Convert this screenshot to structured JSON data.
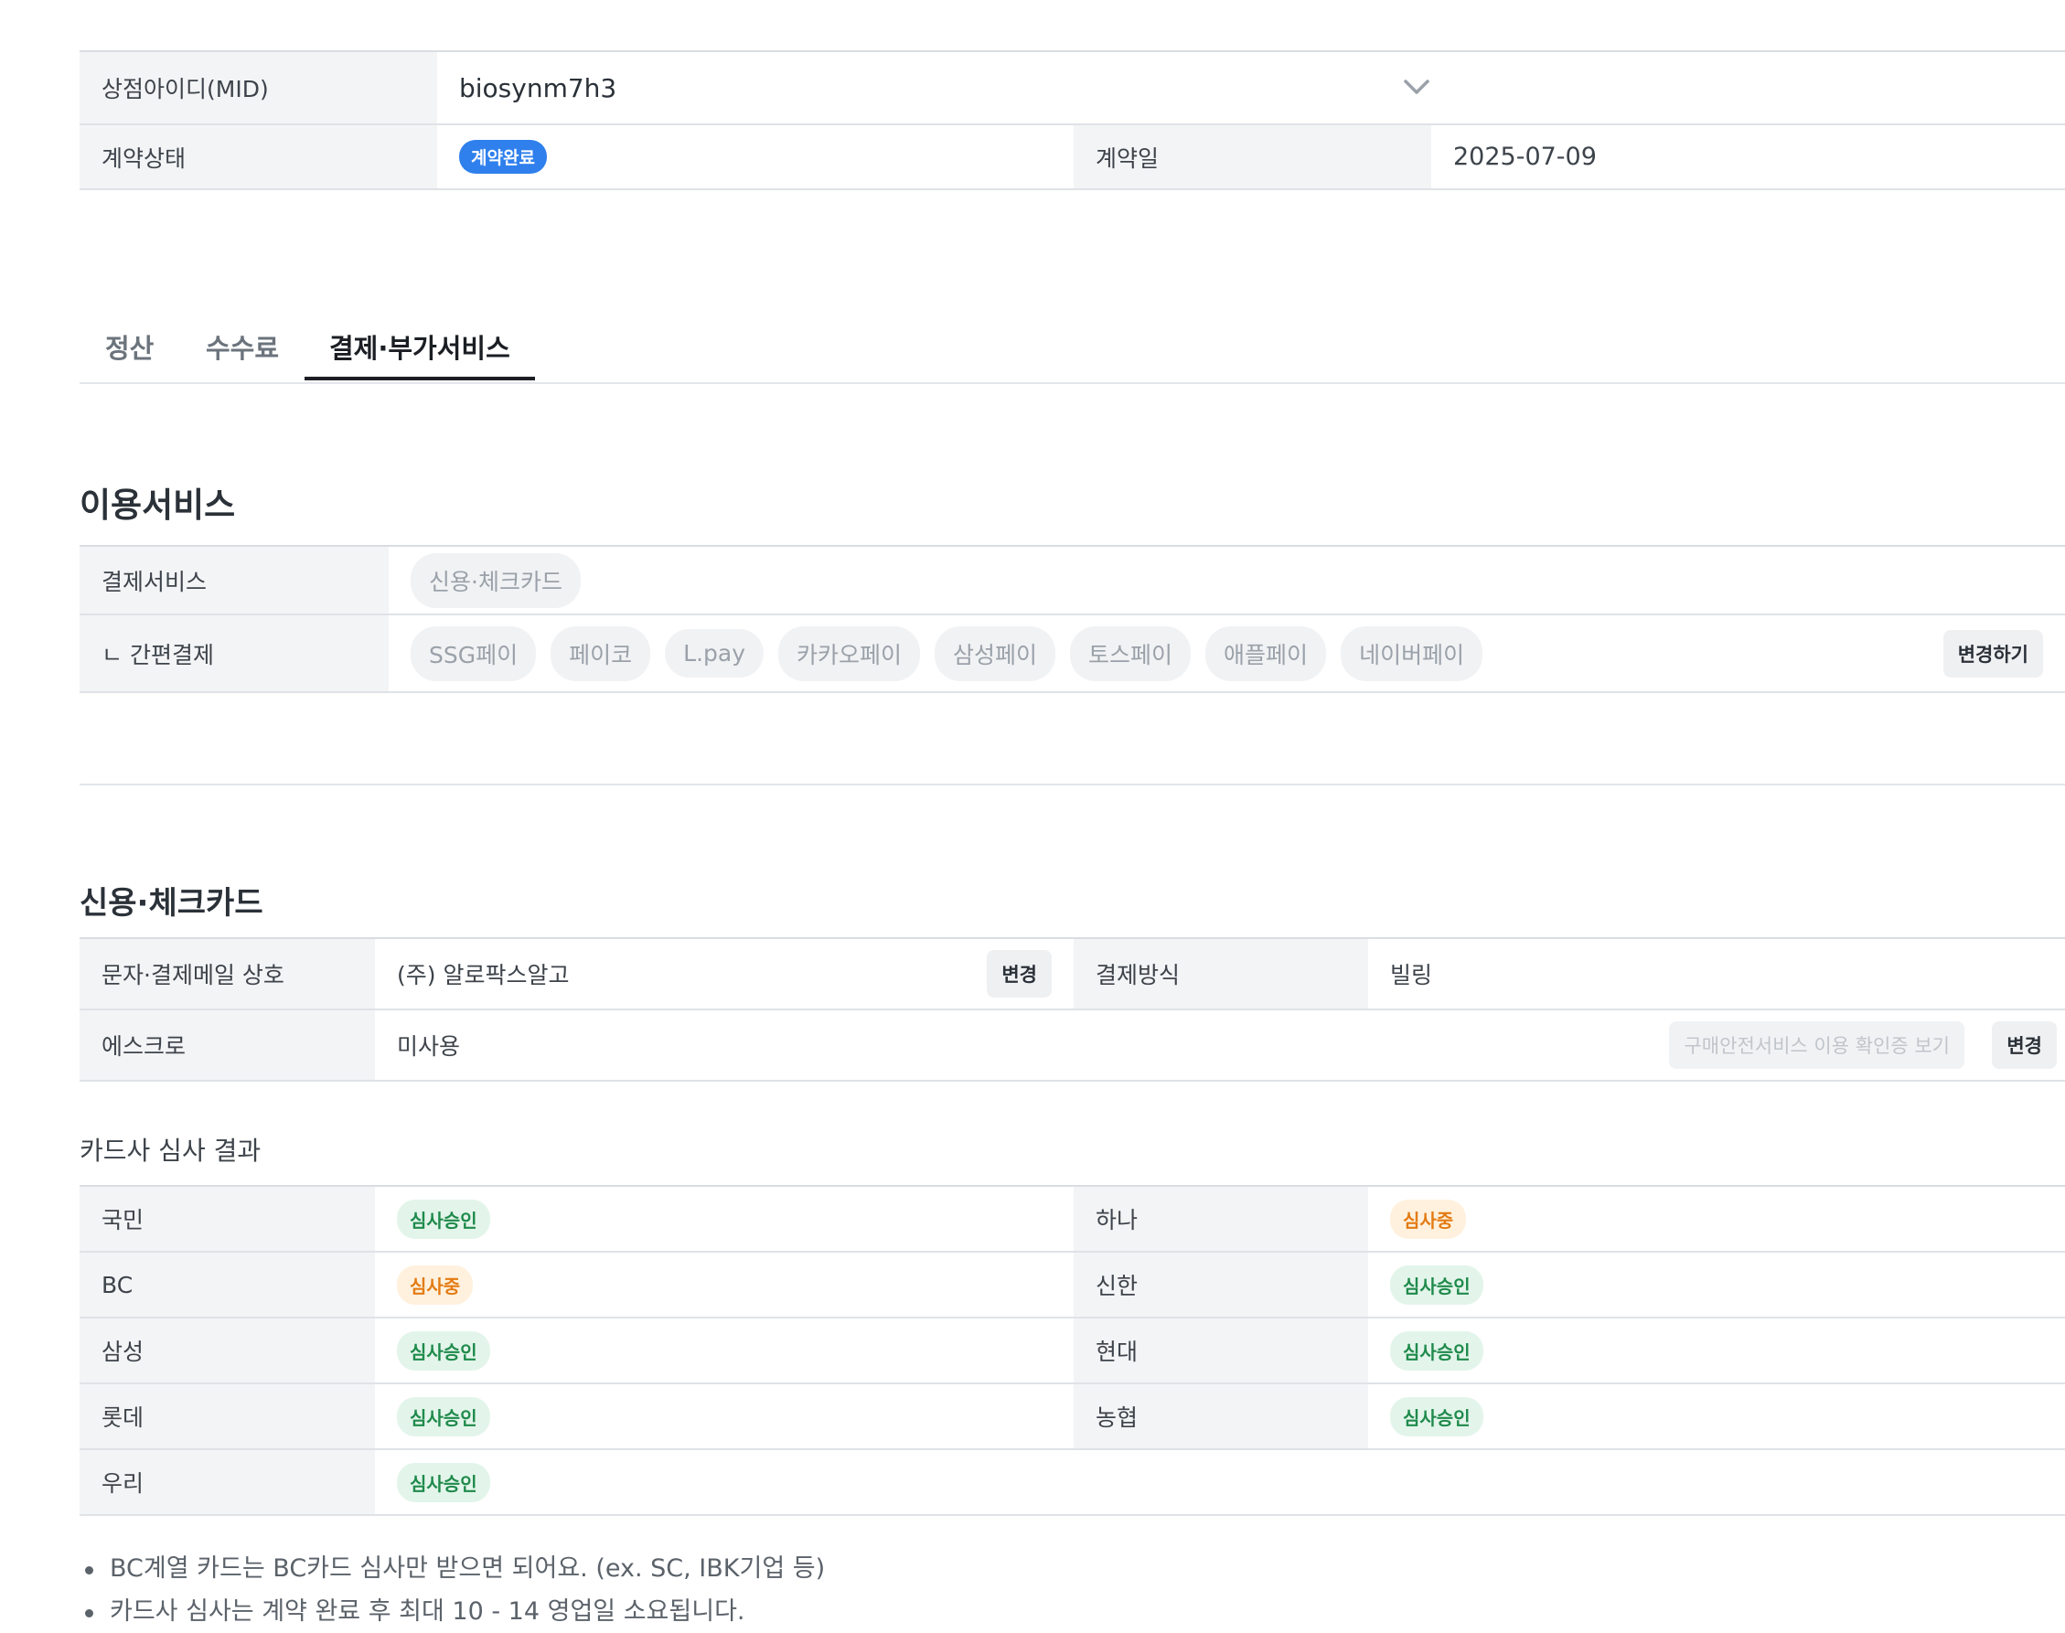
{
  "merchant": {
    "mid_label": "상점아이디(MID)",
    "mid_value": "biosynm7h3",
    "contract_status_label": "계약상태",
    "contract_status_value": "계약완료",
    "contract_date_label": "계약일",
    "contract_date_value": "2025-07-09"
  },
  "tabs": [
    {
      "label": "정산",
      "active": false
    },
    {
      "label": "수수료",
      "active": false
    },
    {
      "label": "결제·부가서비스",
      "active": true
    }
  ],
  "services": {
    "title": "이용서비스",
    "payment_label": "결제서비스",
    "payment_chip": "신용·체크카드",
    "easy_pay_label": "ㄴ 간편결제",
    "easy_pay_chips": [
      "SSG페이",
      "페이코",
      "L.pay",
      "카카오페이",
      "삼성페이",
      "토스페이",
      "애플페이",
      "네이버페이"
    ],
    "change_button": "변경하기"
  },
  "card": {
    "title": "신용·체크카드",
    "sms_label": "문자·결제메일 상호",
    "sms_value": "(주) 알로팍스알고",
    "sms_change": "변경",
    "method_label": "결제방식",
    "method_value": "빌링",
    "escrow_label": "에스크로",
    "escrow_value": "미사용",
    "escrow_cert_button": "구매안전서비스 이용 확인증 보기",
    "escrow_change": "변경"
  },
  "review": {
    "title": "카드사 심사 결과",
    "rows": [
      [
        {
          "name": "국민",
          "status": "심사승인",
          "kind": "ok"
        },
        {
          "name": "하나",
          "status": "심사중",
          "kind": "wait"
        }
      ],
      [
        {
          "name": "BC",
          "status": "심사중",
          "kind": "wait"
        },
        {
          "name": "신한",
          "status": "심사승인",
          "kind": "ok"
        }
      ],
      [
        {
          "name": "삼성",
          "status": "심사승인",
          "kind": "ok"
        },
        {
          "name": "현대",
          "status": "심사승인",
          "kind": "ok"
        }
      ],
      [
        {
          "name": "롯데",
          "status": "심사승인",
          "kind": "ok"
        },
        {
          "name": "농협",
          "status": "심사승인",
          "kind": "ok"
        }
      ],
      [
        {
          "name": "우리",
          "status": "심사승인",
          "kind": "ok"
        }
      ]
    ],
    "notes": [
      "BC계열 카드는 BC카드 심사만 받으면 되어요. (ex. SC, IBK기업 등)",
      "카드사 심사는 계약 완료 후 최대 10 - 14 영업일 소요됩니다."
    ]
  },
  "colors": {
    "accent_blue": "#2f80ed",
    "approved_green": "#1f8a4c",
    "pending_orange": "#e37b12"
  }
}
